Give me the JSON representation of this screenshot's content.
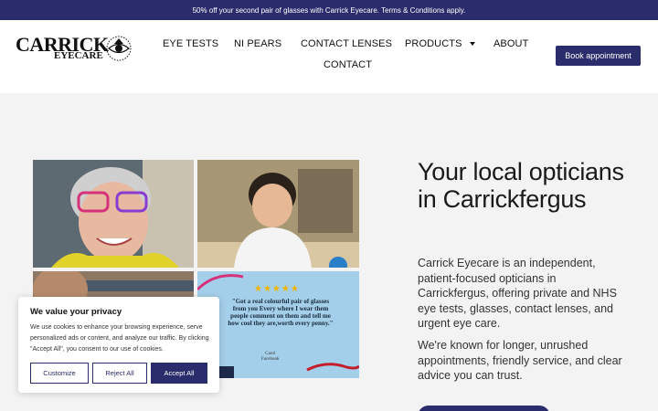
{
  "promo": {
    "text": "50% off your second pair of glasses with Carrick Eyecare. Terms & Conditions apply."
  },
  "logo": {
    "line1": "CARRICK",
    "line2": "EYECARE"
  },
  "nav": {
    "items": [
      "EYE TESTS",
      "NI PEARS",
      "CONTACT LENSES",
      "PRODUCTS",
      "ABOUT",
      "CONTACT"
    ],
    "book_label": "Book appointment"
  },
  "gallery": {
    "review": {
      "stars": "★★★★★",
      "quote": "\"Got a real colourful pair of glasses from you Every where I wear them people comment on them and tell me how cool they are,worth every penny.\"",
      "name": "Carol",
      "source": "Facebook"
    }
  },
  "hero": {
    "title": "Your local opticians in Carrickfergus",
    "p1": "Carrick Eyecare is an independent, patient-focused opticians in Carrickfergus, offering private and NHS eye tests, glasses, contact lenses, and urgent eye care.",
    "p2": "We're known for longer, unrushed appointments, friendly service, and clear advice you can trust."
  },
  "cookie": {
    "title": "We value your privacy",
    "text": "We use cookies to enhance your browsing experience, serve personalized ads or content, and analyze our traffic. By clicking \"Accept All\", you consent to our use of cookies.",
    "customize": "Customize",
    "reject": "Reject All",
    "accept": "Accept All"
  },
  "colors": {
    "brand": "#2b2c6b",
    "star": "#f0b400"
  }
}
